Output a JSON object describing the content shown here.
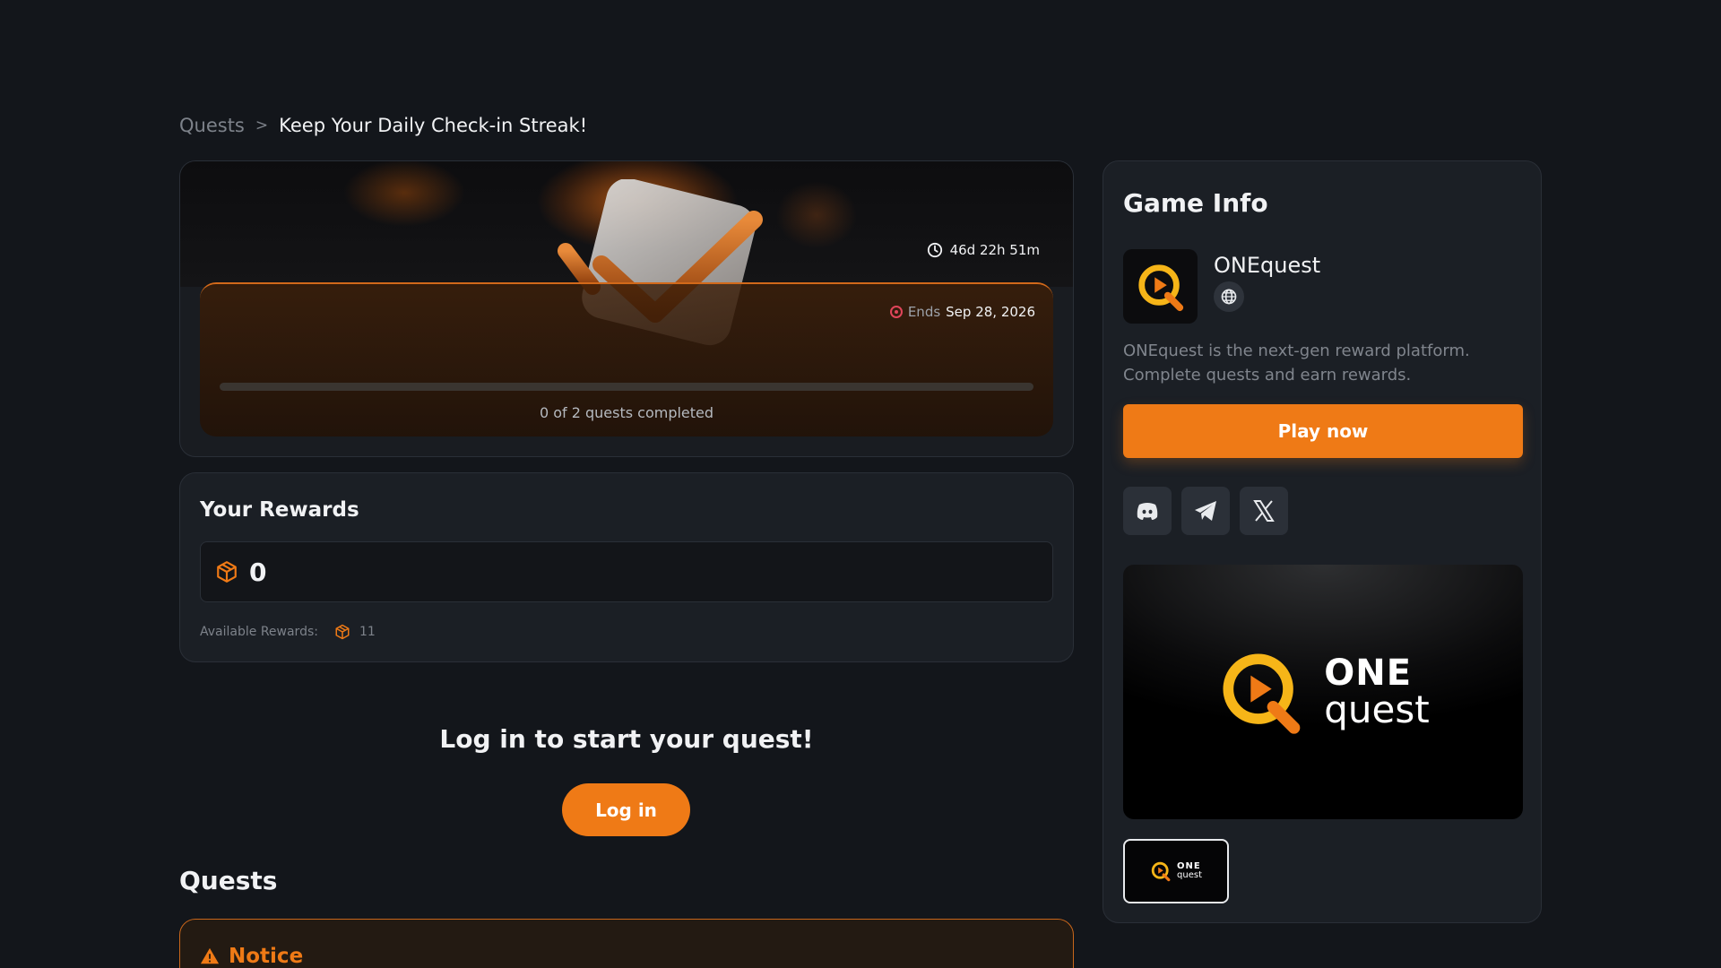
{
  "breadcrumb": {
    "root": "Quests",
    "separator": ">",
    "current": "Keep Your Daily Check-in Streak!"
  },
  "hero": {
    "time_left": "46d 22h 51m",
    "ends_label": "Ends",
    "ends_date": "Sep 28, 2026",
    "progress_text": "0 of 2 quests completed",
    "progress_fraction": 0
  },
  "rewards": {
    "title": "Your Rewards",
    "amount": "0",
    "available_label": "Available Rewards:",
    "available_count": "11",
    "icon": "cube-icon"
  },
  "login": {
    "title": "Log in to start your quest!",
    "button": "Log in"
  },
  "quests": {
    "title": "Quests",
    "notice_title": "Notice"
  },
  "game_info": {
    "title": "Game Info",
    "name": "ONEquest",
    "description": "ONEquest is the next-gen reward platform. Complete quests and earn rewards.",
    "play_button": "Play now",
    "socials": [
      "discord-icon",
      "telegram-icon",
      "x-icon"
    ],
    "brand_one": "ONE",
    "brand_quest": "quest"
  },
  "colors": {
    "accent": "#ef7a16",
    "background": "#13161b",
    "card": "#1b1f25"
  }
}
